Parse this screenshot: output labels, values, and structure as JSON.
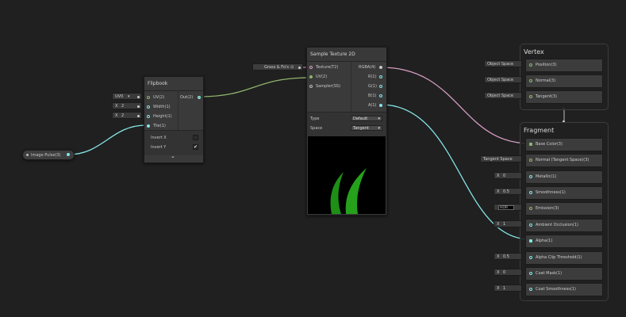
{
  "property_node": {
    "label": "Image Pulse(3)"
  },
  "flipbook": {
    "title": "Flipbook",
    "inputs": [
      {
        "label": "UV(2)",
        "value_label": "UV0"
      },
      {
        "label": "Width(1)",
        "x": "X",
        "value": "2"
      },
      {
        "label": "Height(1)",
        "x": "X",
        "value": "2"
      },
      {
        "label": "Tile(1)"
      }
    ],
    "output": "Out(2)",
    "invert_x": "Invert X",
    "invert_y": "Invert Y",
    "invert_y_check": "✔",
    "collapse_icon": "⌄"
  },
  "texture_property": {
    "label": "Grass & Fo's"
  },
  "sample_texture": {
    "title": "Sample Texture 2D",
    "inputs": [
      "Texture(T2)",
      "UV(2)",
      "Sampler(SS)"
    ],
    "outputs": [
      "RGBA(4)",
      "R(1)",
      "G(1)",
      "B(1)",
      "A(1)"
    ],
    "type_label": "Type",
    "type_value": "Default",
    "space_label": "Space",
    "space_value": "Tangent"
  },
  "vertex": {
    "title": "Vertex",
    "blocks": [
      {
        "label": "Position(3)",
        "input": "Object Space"
      },
      {
        "label": "Normal(3)",
        "input": "Object Space"
      },
      {
        "label": "Tangent(3)",
        "input": "Object Space"
      }
    ]
  },
  "fragment": {
    "title": "Fragment",
    "blocks": [
      {
        "label": "Base Color(3)",
        "input": ""
      },
      {
        "label": "Normal (Tangent Space)(3)",
        "input": "Tangent Space"
      },
      {
        "label": "Metallic(1)",
        "x": "X",
        "value": "0"
      },
      {
        "label": "Smoothness(1)",
        "x": "X",
        "value": "0.5"
      },
      {
        "label": "Emission(3)",
        "hdr": "HDR"
      },
      {
        "label": "Ambient Occlusion(1)",
        "x": "X",
        "value": "1"
      },
      {
        "label": "Alpha(1)",
        "input": ""
      },
      {
        "label": "Alpha Clip Threshold(1)",
        "x": "X",
        "value": "0.5"
      },
      {
        "label": "Coat Mask(1)",
        "x": "X",
        "value": "0"
      },
      {
        "label": "Coat Smoothness(1)",
        "x": "X",
        "value": "1"
      }
    ]
  },
  "colors": {
    "wire_uv": "#8fb36b",
    "wire_float": "#84e4e7",
    "wire_color": "#d49cc1",
    "background": "#202020"
  }
}
